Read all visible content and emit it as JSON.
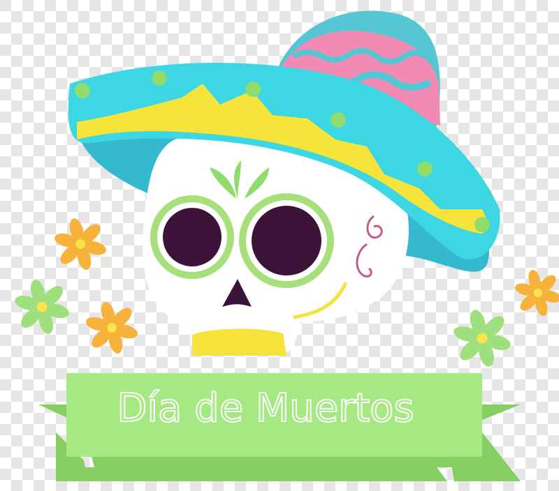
{
  "banner": {
    "text": "Día de Muertos"
  },
  "colors": {
    "checker_light": "#ffffff",
    "checker_dark": "#e6e6e6",
    "hat_brim": "#3dd6e3",
    "hat_brim_shade": "#34b9cf",
    "hat_crown_top": "#55c7d4",
    "hat_crown_pink": "#f28bb4",
    "hat_band_yellow": "#f7e43b",
    "hat_dots": "#8fdc6a",
    "skull": "#ffffff",
    "eye_ring": "#a7e07b",
    "eye": "#3c1439",
    "teeth": "#f5e23a",
    "swirl": "#c35a8a",
    "flower_orange": "#f6b23b",
    "flower_green": "#9fe07e",
    "flower_center": "#fde34a",
    "banner": "#a6e884",
    "banner_shadow": "#86cf63"
  },
  "icons": [
    "sombrero-icon",
    "sugar-skull-icon",
    "flower-icon",
    "ribbon-banner-icon"
  ]
}
